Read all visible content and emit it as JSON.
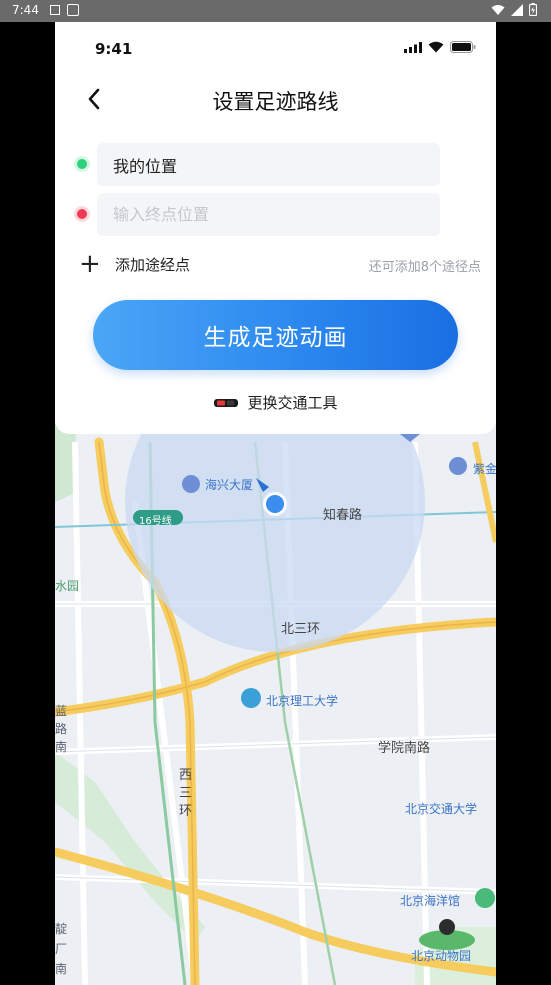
{
  "system_status": {
    "time": "7:44"
  },
  "inner_status": {
    "time": "9:41"
  },
  "header": {
    "title": "设置足迹路线"
  },
  "route": {
    "start_value": "我的位置",
    "end_placeholder": "输入终点位置",
    "add_waypoint_label": "添加途经点",
    "waypoint_hint": "还可添加8个途径点"
  },
  "generate_button_label": "生成足迹动画",
  "change_transport_label": "更换交通工具",
  "map": {
    "labels": {
      "haixing": "海兴大厦",
      "line16": "16号线",
      "zhichun": "知春路",
      "shuiyuan": "水园",
      "beisanhuan": "北三环",
      "bit": "北京理工大学",
      "xueyuan_nanlu": "学院南路",
      "xisanhuan": "西三环",
      "bjtu": "北京交通大学",
      "aquarium": "北京海洋馆",
      "zoo": "北京动物园",
      "zi": "紫金",
      "lan": "蓝",
      "dian": "靛",
      "chang": "厂",
      "nan": "南",
      "lu": "路",
      "nan2": "南"
    }
  },
  "colors": {
    "accent": "#2a86ee",
    "start_dot": "#2dd37a",
    "end_dot": "#f03a55",
    "major_road": "#f7cc5e",
    "location_circle": "#c9d9f3"
  }
}
